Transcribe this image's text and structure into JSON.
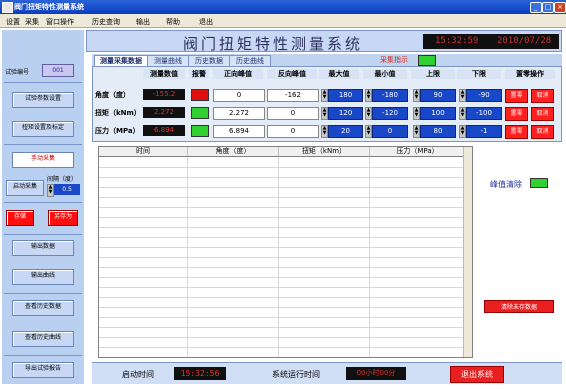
{
  "window": {
    "title": "阀门扭矩特性测量系统"
  },
  "menu": [
    "设置",
    "采集",
    "窗口操作",
    "历史查询",
    "输出",
    "帮助",
    "退出"
  ],
  "header": {
    "title": "阀门扭矩特性测量系统",
    "time": "15:32:59",
    "date": "2010/07/28"
  },
  "left": {
    "test_no_label": "试验编号",
    "test_no_value": "001",
    "btn_params": "试验参数设置",
    "btn_torque_sensor": "扭矩设置及标定",
    "manual_collect": "手动采集",
    "auto_collect": "启动采集",
    "interval_label": "间隔（度）",
    "interval_value": "0.5",
    "btn_save": "存储",
    "btn_save_as": "另存为",
    "btn_output_data": "输出数据",
    "btn_output_curve": "输出曲线",
    "btn_view_hist_data": "查看历史数据",
    "btn_view_hist_curve": "查看历史曲线",
    "btn_export_report": "导出试验报告"
  },
  "tabs": [
    "测量采集数据",
    "测量曲线",
    "历史数据",
    "历史曲线"
  ],
  "collect_indicator": "采集指示",
  "columns": [
    "测量数值",
    "报警",
    "正向峰值",
    "反向峰值",
    "最大值",
    "最小值",
    "上限",
    "下限",
    "置零操作"
  ],
  "rows": [
    {
      "label": "角度（度）",
      "value": "-155.2",
      "fwd_peak": "0",
      "rev_peak": "-162",
      "max": "180",
      "min": "-180",
      "upper": "90",
      "lower": "-90",
      "alarm": "#e01010"
    },
    {
      "label": "扭矩（kNm）",
      "value": "2.272",
      "fwd_peak": "2.272",
      "rev_peak": "0",
      "max": "120",
      "min": "-120",
      "upper": "100",
      "lower": "-100",
      "alarm": "#30d030"
    },
    {
      "label": "压力（MPa）",
      "value": "6.894",
      "fwd_peak": "6.894",
      "rev_peak": "0",
      "max": "20",
      "min": "0",
      "upper": "80",
      "lower": "-1",
      "alarm": "#30d030"
    }
  ],
  "zero_btn": "置零",
  "cancel_btn": "取消",
  "table": {
    "headers": [
      "时间",
      "角度（度）",
      "扭矩（kNm）",
      "压力（MPa）"
    ]
  },
  "peak_clear": "峰值清除",
  "clear_unsaved": "清除未存数据",
  "bottom": {
    "start_time_label": "启动时间",
    "start_time": "15:32:56",
    "runtime_label": "系统运行时间",
    "runtime": "00小时00分",
    "exit": "退出系统"
  }
}
